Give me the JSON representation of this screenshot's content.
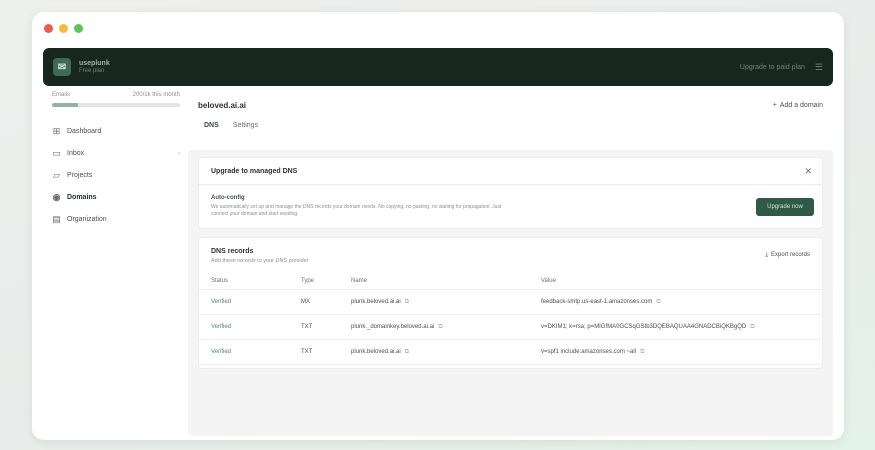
{
  "window": {
    "traffic_lights": [
      "close",
      "minimize",
      "maximize"
    ]
  },
  "topbar": {
    "brand_name": "useplunk",
    "brand_sub": "Free plan",
    "link": "Upgrade to paid plan",
    "menu_icon": "menu-icon"
  },
  "sidebar": {
    "usage_left": "Emails",
    "usage_right": "200/1k this month",
    "usage_fraction": 0.2,
    "items": [
      {
        "label": "Dashboard",
        "icon": "grid-icon",
        "active": false
      },
      {
        "label": "Inbox",
        "icon": "inbox-icon",
        "active": false
      },
      {
        "label": "Projects",
        "icon": "folder-icon",
        "active": false
      },
      {
        "label": "Domains",
        "icon": "globe-icon",
        "active": true
      },
      {
        "label": "Organization",
        "icon": "building-icon",
        "active": false
      }
    ]
  },
  "main": {
    "title": "beloved.ai.ai",
    "add_domain": "Add a domain",
    "tabs": [
      "DNS",
      "Settings"
    ]
  },
  "upgrade": {
    "title": "Upgrade to managed DNS",
    "body_title": "Auto-config",
    "body_text": "We automatically set up and manage the DNS records your domain needs. No copying, no pasting, no waiting for propagation. Just connect your domain and start sending.",
    "button": "Upgrade now"
  },
  "records": {
    "title": "DNS records",
    "subtitle": "Add these records to your DNS provider",
    "export": "Export records",
    "columns": [
      "Status",
      "Type",
      "Name",
      "Value"
    ],
    "rows": [
      {
        "status": "Verified",
        "type": "MX",
        "name": "plunk.beloved.ai.ai",
        "value": "feedback-smtp.us-east-1.amazonses.com"
      },
      {
        "status": "Verified",
        "type": "TXT",
        "name": "plunk._domainkey.beloved.ai.ai",
        "value": "v=DKIM1; k=rsa; p=MIGfMA0GCSqGSIb3DQEBAQUAA4GNADCBiQKBgQD"
      },
      {
        "status": "Verified",
        "type": "TXT",
        "name": "plunk.beloved.ai.ai",
        "value": "v=spf1 include:amazonses.com ~all"
      }
    ]
  },
  "colors": {
    "topbar": "#17261f",
    "accent": "#2f5a47",
    "status_verified": "#4f8a6e"
  }
}
